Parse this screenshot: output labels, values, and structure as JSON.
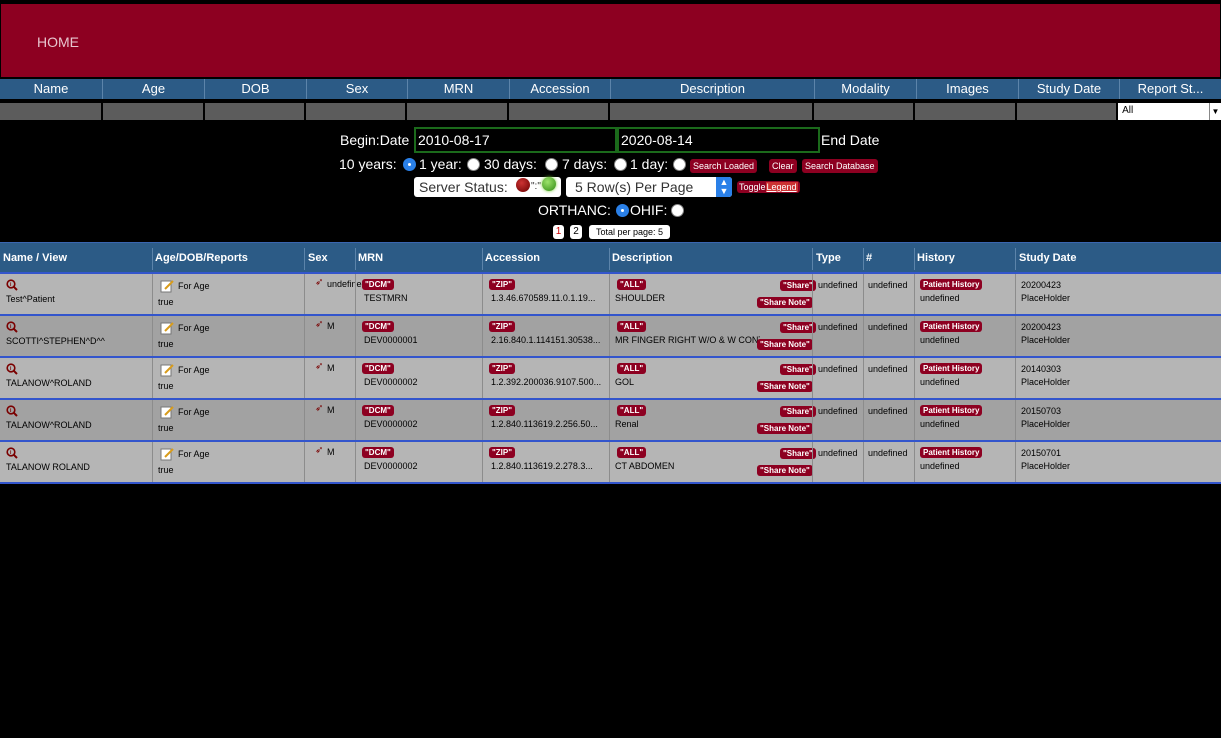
{
  "nav": {
    "home": "HOME"
  },
  "columns": [
    "Name",
    "Age",
    "DOB",
    "Sex",
    "MRN",
    "Accession",
    "Description",
    "Modality",
    "Images",
    "Study Date",
    "Report St..."
  ],
  "filter_select": "All",
  "search": {
    "begin_label": "Begin:Date",
    "begin_value": "2010-08-17",
    "end_value": "2020-08-14",
    "end_label": "End Date",
    "ranges": [
      "10 years:",
      "1 year:",
      "30 days:",
      "7 days:",
      "1 day:"
    ],
    "selected_range": "10 years:",
    "buttons": {
      "search_loaded": "Search Loaded",
      "clear": "Clear",
      "search_database": "Search Database"
    },
    "server_status_label": "Server Status:",
    "server_sep": "\":\"",
    "rows_per_page": "5 Row(s) Per Page",
    "toggle_label": "Toggle",
    "legend_label": "Legend",
    "orthanc_label": "ORTHANC:",
    "ohif_label": "OHIF:",
    "pages": [
      "1",
      "2"
    ],
    "total_per_page": "Total per page: 5"
  },
  "grid": {
    "headers": {
      "name": "Name / View",
      "age": "Age/DOB/Reports",
      "sex": "Sex",
      "mrn": "MRN",
      "accession": "Accession",
      "description": "Description",
      "type": "Type",
      "count": "#",
      "history": "History",
      "study_date": "Study Date"
    },
    "labels": {
      "for_age": "For Age",
      "dcm": "\"DCM\"",
      "zip": "\"ZIP\"",
      "all": "\"ALL\"",
      "share": "\"Share\"",
      "share_note": "\"Share Note\"",
      "patient_history": "Patient History"
    },
    "rows": [
      {
        "name": "Test^Patient",
        "reports": "true",
        "sex": "undefined",
        "mrn": "TESTMRN",
        "accession": "1.3.46.670589.11.0.1.19...",
        "description": "SHOULDER",
        "type": "undefined",
        "count": "undefined",
        "history": "undefined",
        "study_date": "20200423",
        "placeholder": "PlaceHolder"
      },
      {
        "name": "SCOTTI^STEPHEN^D^^",
        "reports": "true",
        "sex": "M",
        "mrn": "DEV0000001",
        "accession": "2.16.840.1.114151.30538...",
        "description": "MR FINGER RIGHT W/O & W CONTR",
        "type": "undefined",
        "count": "undefined",
        "history": "undefined",
        "study_date": "20200423",
        "placeholder": "PlaceHolder"
      },
      {
        "name": "TALANOW^ROLAND",
        "reports": "true",
        "sex": "M",
        "mrn": "DEV0000002",
        "accession": "1.2.392.200036.9107.500...",
        "description": "GOL",
        "type": "undefined",
        "count": "undefined",
        "history": "undefined",
        "study_date": "20140303",
        "placeholder": "PlaceHolder"
      },
      {
        "name": "TALANOW^ROLAND",
        "reports": "true",
        "sex": "M",
        "mrn": "DEV0000002",
        "accession": "1.2.840.113619.2.256.50...",
        "description": "Renal",
        "type": "undefined",
        "count": "undefined",
        "history": "undefined",
        "study_date": "20150703",
        "placeholder": "PlaceHolder"
      },
      {
        "name": "TALANOW ROLAND",
        "reports": "true",
        "sex": "M",
        "mrn": "DEV0000002",
        "accession": "1.2.840.113619.2.278.3...",
        "description": "CT ABDOMEN",
        "type": "undefined",
        "count": "undefined",
        "history": "undefined",
        "study_date": "20150701",
        "placeholder": "PlaceHolder"
      }
    ]
  },
  "colors": {
    "brand": "#8d0021",
    "header_blue": "#2c5b86",
    "date_border": "#1b6a1b",
    "status_red": "#8a0a0a",
    "status_green": "#52b52a"
  }
}
